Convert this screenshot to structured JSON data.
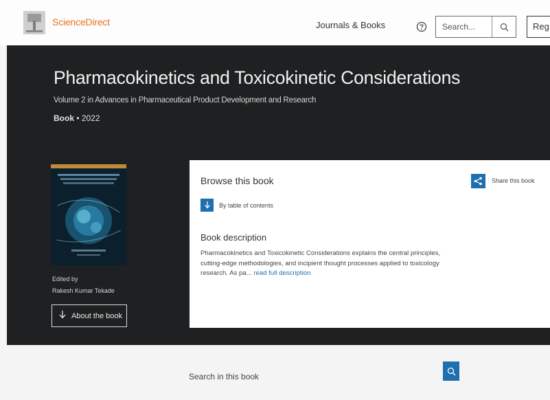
{
  "header": {
    "brand": "ScienceDirect",
    "nav_link": "Journals & Books",
    "search_placeholder": "Search...",
    "register_label": "Reg"
  },
  "book": {
    "title": "Pharmacokinetics and Toxicokinetic Considerations",
    "subtitle": "Volume 2 in Advances in Pharmaceutical Product Development and Research",
    "type": "Book",
    "year": "2022",
    "edited_by_label": "Edited by",
    "editor": "Rakesh Kumar Tekade",
    "about_label": "About the book"
  },
  "browse": {
    "title": "Browse this book",
    "toc_label": "By table of contents",
    "share_label": "Share this book",
    "description_title": "Book description",
    "description_text": "Pharmacokinetics and Toxicokinetic Considerations explains the central principles, cutting-edge methodologies, and incipient thought processes applied to toxicology research. As pa...",
    "read_more": "read full description"
  },
  "book_search": {
    "placeholder": "Search in this book"
  },
  "colors": {
    "brand_orange": "#e9711c",
    "accent_blue": "#1e6fae",
    "hero_bg": "#1f2021"
  },
  "icons": [
    "sciencedirect-logo-icon",
    "help-icon",
    "search-icon",
    "share-icon",
    "table-of-contents-icon",
    "arrow-down-icon"
  ]
}
